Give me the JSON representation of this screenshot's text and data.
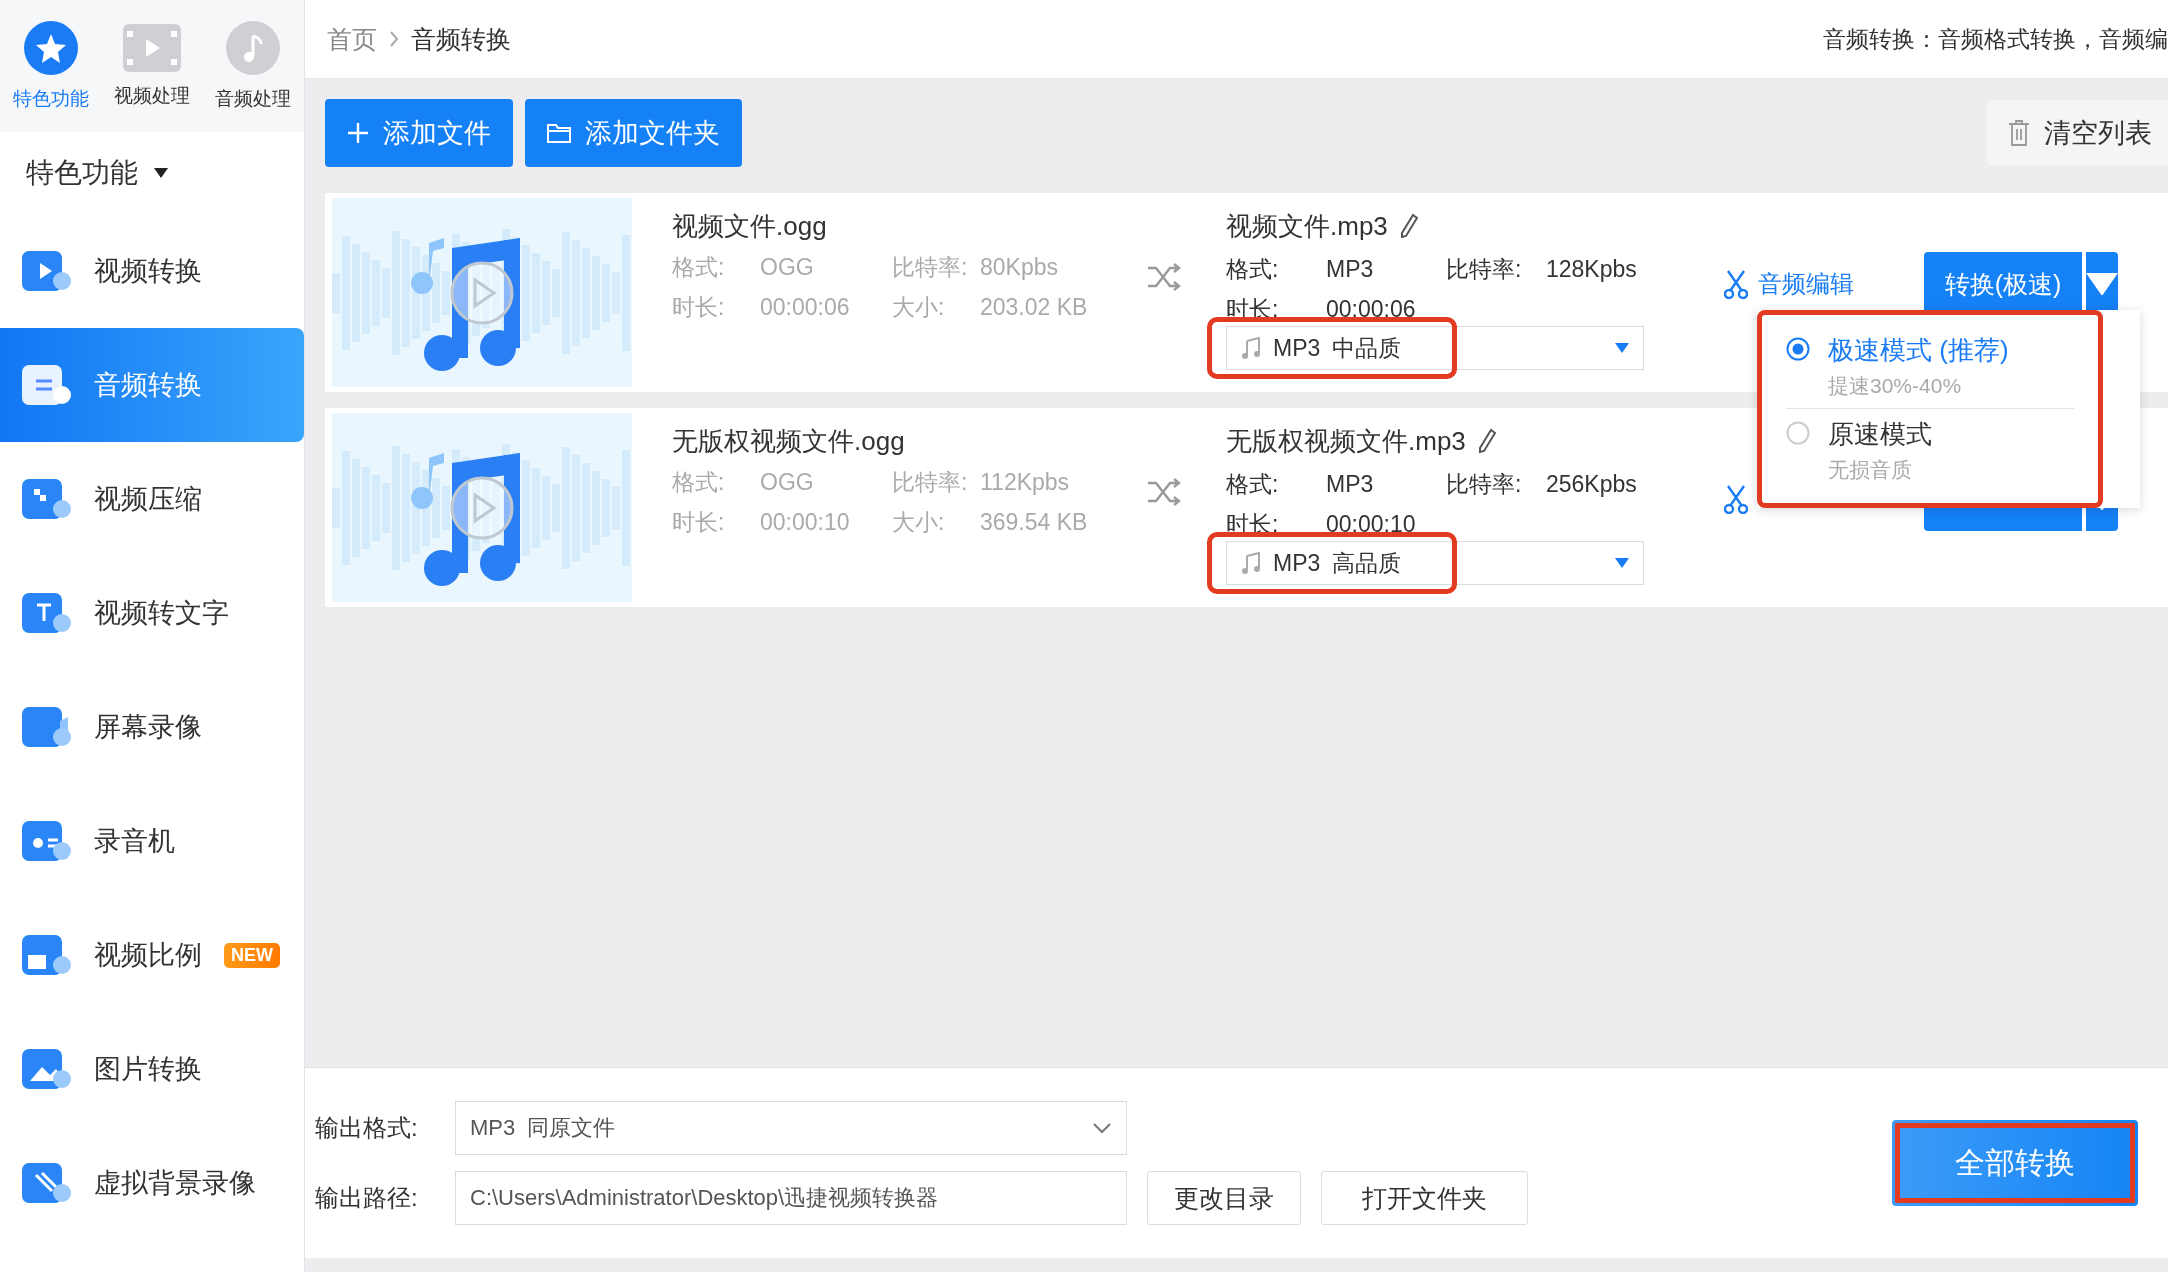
{
  "top_tabs": [
    {
      "label": "特色功能",
      "selected": true
    },
    {
      "label": "视频处理",
      "selected": false
    },
    {
      "label": "音频处理",
      "selected": false
    }
  ],
  "sidebar": {
    "section": "特色功能",
    "items": [
      {
        "label": "视频转换",
        "selected": false
      },
      {
        "label": "音频转换",
        "selected": true
      },
      {
        "label": "视频压缩",
        "selected": false
      },
      {
        "label": "视频转文字",
        "selected": false
      },
      {
        "label": "屏幕录像",
        "selected": false
      },
      {
        "label": "录音机",
        "selected": false
      },
      {
        "label": "视频比例",
        "selected": false,
        "badge": "NEW"
      },
      {
        "label": "图片转换",
        "selected": false
      },
      {
        "label": "虚拟背景录像",
        "selected": false
      }
    ]
  },
  "breadcrumb": [
    "首页",
    "音频转换"
  ],
  "description": "音频转换：音频格式转换，音频编",
  "toolbar": {
    "add_file": "添加文件",
    "add_folder": "添加文件夹",
    "clear": "清空列表"
  },
  "files": [
    {
      "name": "视频文件.ogg",
      "source": [
        [
          "格式:",
          "OGG",
          "比特率:",
          "80Kpbs"
        ],
        [
          "时长:",
          "00:00:06",
          "大小:",
          "203.02 KB"
        ]
      ],
      "output": {
        "name": "视频文件.mp3",
        "lines": [
          [
            "格式:",
            "MP3",
            "比特率:",
            "128Kpbs"
          ],
          [
            "时长:",
            "00:00:06"
          ]
        ],
        "quality": {
          "format": "MP3",
          "level": "中品质",
          "highlighted": true
        }
      },
      "edit_link": "音频编辑",
      "convert": "转换(极速)"
    },
    {
      "name": "无版权视频文件.ogg",
      "source": [
        [
          "格式:",
          "OGG",
          "比特率:",
          "112Kpbs"
        ],
        [
          "时长:",
          "00:00:10",
          "大小:",
          "369.54 KB"
        ]
      ],
      "output": {
        "name": "无版权视频文件.mp3",
        "lines": [
          [
            "格式:",
            "MP3",
            "比特率:",
            "256Kpbs"
          ],
          [
            "时长:",
            "00:00:10"
          ]
        ],
        "quality": {
          "format": "MP3",
          "level": "高品质",
          "highlighted": true
        }
      }
    }
  ],
  "speed_menu": {
    "highlighted": true,
    "options": [
      {
        "label": "极速模式 (推荐)",
        "hint": "提速30%-40%",
        "selected": true
      },
      {
        "label": "原速模式",
        "hint": "无损音质",
        "selected": false
      }
    ]
  },
  "output_settings": {
    "format_label": "输出格式:",
    "format": "MP3  同原文件",
    "path_label": "输出路径:",
    "path": "C:\\Users\\Administrator\\Desktop\\迅捷视频转换器",
    "change_dir": "更改目录",
    "open_folder": "打开文件夹",
    "convert_all": {
      "label": "全部转换",
      "highlighted": true
    }
  }
}
